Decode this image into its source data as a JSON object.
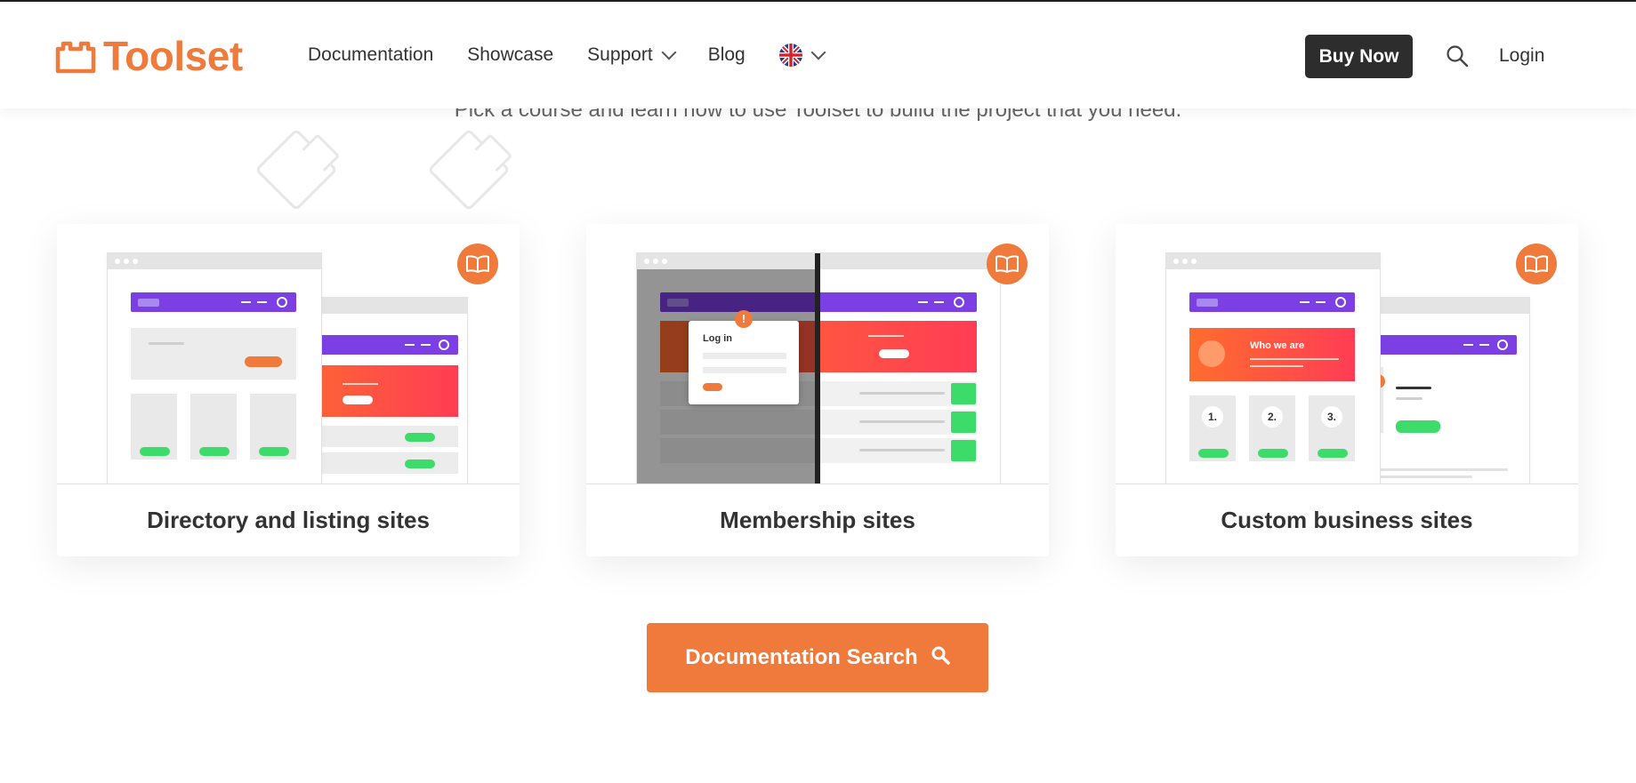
{
  "brand": {
    "name": "Toolset",
    "color": "#ef7a3c"
  },
  "nav": {
    "items": [
      {
        "label": "Documentation"
      },
      {
        "label": "Showcase"
      },
      {
        "label": "Support"
      },
      {
        "label": "Blog"
      }
    ],
    "language_icon": "uk-flag-icon"
  },
  "header": {
    "buy_label": "Buy Now",
    "login_label": "Login"
  },
  "intro": {
    "subtitle": "Pick a course and learn how to use Toolset to build the project that you need."
  },
  "cards": [
    {
      "title": "Directory and listing sites",
      "icon": "book-icon"
    },
    {
      "title": "Membership sites",
      "icon": "book-icon",
      "login_text": "Log in"
    },
    {
      "title": "Custom business sites",
      "icon": "book-icon",
      "who_text": "Who we are",
      "steps": [
        "1.",
        "2.",
        "3."
      ]
    }
  ],
  "doc_search": {
    "label": "Documentation Search"
  },
  "colors": {
    "accent": "#ef7a3c",
    "dark": "#2d2d2d",
    "purple": "#7b3fe4",
    "green": "#3ddc6a"
  }
}
